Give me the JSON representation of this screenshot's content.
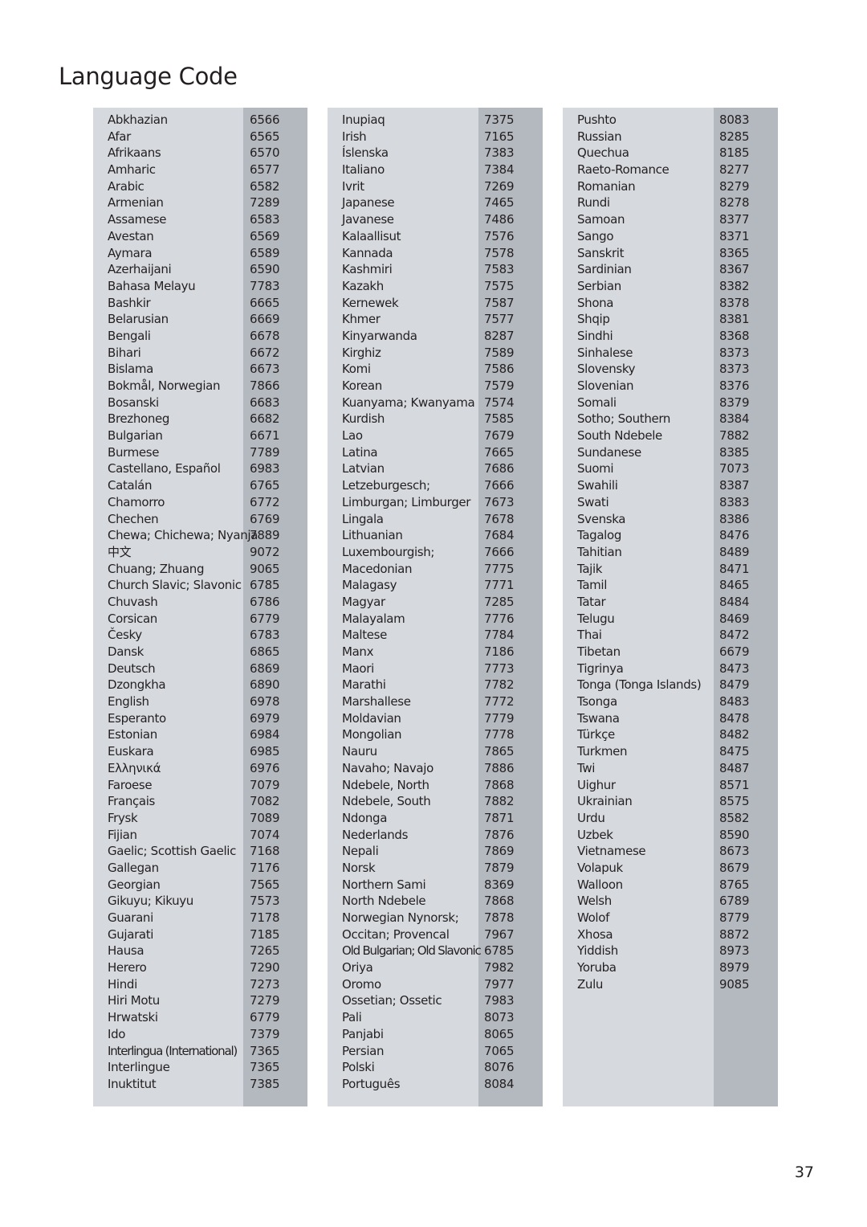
{
  "title": "Language Code",
  "page_number": "37",
  "colors": {
    "name_bg": "#d6dade",
    "code_bg": "#b4b8bf",
    "text": "#231f20"
  },
  "columns": [
    {
      "rows": [
        {
          "name": "Abkhazian",
          "code": "6566"
        },
        {
          "name": "Afar",
          "code": "6565"
        },
        {
          "name": "Afrikaans",
          "code": "6570"
        },
        {
          "name": "Amharic",
          "code": "6577"
        },
        {
          "name": "Arabic",
          "code": "6582"
        },
        {
          "name": "Armenian",
          "code": "7289"
        },
        {
          "name": "Assamese",
          "code": "6583"
        },
        {
          "name": "Avestan",
          "code": "6569"
        },
        {
          "name": "Aymara",
          "code": "6589"
        },
        {
          "name": "Azerhaijani",
          "code": "6590"
        },
        {
          "name": "Bahasa Melayu",
          "code": "7783"
        },
        {
          "name": "Bashkir",
          "code": "6665"
        },
        {
          "name": "Belarusian",
          "code": "6669"
        },
        {
          "name": "Bengali",
          "code": "6678"
        },
        {
          "name": "Bihari",
          "code": "6672"
        },
        {
          "name": "Bislama",
          "code": "6673"
        },
        {
          "name": "Bokmål, Norwegian",
          "code": "7866"
        },
        {
          "name": "Bosanski",
          "code": "6683"
        },
        {
          "name": "Brezhoneg",
          "code": "6682"
        },
        {
          "name": "Bulgarian",
          "code": "6671"
        },
        {
          "name": "Burmese",
          "code": "7789"
        },
        {
          "name": "Castellano, Español",
          "code": "6983"
        },
        {
          "name": "Catalán",
          "code": "6765"
        },
        {
          "name": "Chamorro",
          "code": "6772"
        },
        {
          "name": "Chechen",
          "code": "6769"
        },
        {
          "name": "Chewa; Chichewa; Nyanja",
          "code": "7889"
        },
        {
          "name": "中文",
          "code": "9072"
        },
        {
          "name": "Chuang; Zhuang",
          "code": "9065"
        },
        {
          "name": "Church Slavic; Slavonic",
          "code": "6785"
        },
        {
          "name": "Chuvash",
          "code": "6786"
        },
        {
          "name": "Corsican",
          "code": "6779"
        },
        {
          "name": "Česky",
          "code": "6783"
        },
        {
          "name": "Dansk",
          "code": "6865"
        },
        {
          "name": "Deutsch",
          "code": "6869"
        },
        {
          "name": "Dzongkha",
          "code": "6890"
        },
        {
          "name": "English",
          "code": "6978"
        },
        {
          "name": "Esperanto",
          "code": "6979"
        },
        {
          "name": "Estonian",
          "code": "6984"
        },
        {
          "name": "Euskara",
          "code": "6985"
        },
        {
          "name": "Ελληνικά",
          "code": "6976"
        },
        {
          "name": "Faroese",
          "code": "7079"
        },
        {
          "name": "Français",
          "code": "7082"
        },
        {
          "name": "Frysk",
          "code": "7089"
        },
        {
          "name": "Fijian",
          "code": "7074"
        },
        {
          "name": "Gaelic; Scottish Gaelic",
          "code": "7168"
        },
        {
          "name": "Gallegan",
          "code": "7176"
        },
        {
          "name": "Georgian",
          "code": "7565"
        },
        {
          "name": "Gikuyu; Kikuyu",
          "code": "7573"
        },
        {
          "name": "Guarani",
          "code": "7178"
        },
        {
          "name": "Gujarati",
          "code": "7185"
        },
        {
          "name": "Hausa",
          "code": "7265"
        },
        {
          "name": "Herero",
          "code": "7290"
        },
        {
          "name": "Hindi",
          "code": "7273"
        },
        {
          "name": "Hiri Motu",
          "code": "7279"
        },
        {
          "name": "Hrwatski",
          "code": "6779"
        },
        {
          "name": "Ido",
          "code": "7379"
        },
        {
          "name": "Interlingua (International)",
          "code": "7365"
        },
        {
          "name": "Interlingue",
          "code": "7365"
        },
        {
          "name": "Inuktitut",
          "code": "7385"
        }
      ]
    },
    {
      "rows": [
        {
          "name": "Inupiaq",
          "code": "7375"
        },
        {
          "name": "Irish",
          "code": "7165"
        },
        {
          "name": "Íslenska",
          "code": "7383"
        },
        {
          "name": "Italiano",
          "code": "7384"
        },
        {
          "name": "Ivrit",
          "code": "7269"
        },
        {
          "name": "Japanese",
          "code": "7465"
        },
        {
          "name": "Javanese",
          "code": "7486"
        },
        {
          "name": "Kalaallisut",
          "code": "7576"
        },
        {
          "name": "Kannada",
          "code": "7578"
        },
        {
          "name": "Kashmiri",
          "code": "7583"
        },
        {
          "name": "Kazakh",
          "code": "7575"
        },
        {
          "name": "Kernewek",
          "code": "7587"
        },
        {
          "name": "Khmer",
          "code": "7577"
        },
        {
          "name": "Kinyarwanda",
          "code": "8287"
        },
        {
          "name": "Kirghiz",
          "code": "7589"
        },
        {
          "name": "Komi",
          "code": "7586"
        },
        {
          "name": "Korean",
          "code": "7579"
        },
        {
          "name": "Kuanyama; Kwanyama",
          "code": "7574"
        },
        {
          "name": "Kurdish",
          "code": "7585"
        },
        {
          "name": "Lao",
          "code": "7679"
        },
        {
          "name": "Latina",
          "code": "7665"
        },
        {
          "name": "Latvian",
          "code": "7686"
        },
        {
          "name": "Letzeburgesch;",
          "code": "7666"
        },
        {
          "name": "Limburgan; Limburger",
          "code": "7673"
        },
        {
          "name": "Lingala",
          "code": "7678"
        },
        {
          "name": "Lithuanian",
          "code": "7684"
        },
        {
          "name": "Luxembourgish;",
          "code": "7666"
        },
        {
          "name": "Macedonian",
          "code": "7775"
        },
        {
          "name": "Malagasy",
          "code": "7771"
        },
        {
          "name": "Magyar",
          "code": "7285"
        },
        {
          "name": "Malayalam",
          "code": "7776"
        },
        {
          "name": "Maltese",
          "code": "7784"
        },
        {
          "name": "Manx",
          "code": "7186"
        },
        {
          "name": "Maori",
          "code": "7773"
        },
        {
          "name": "Marathi",
          "code": "7782"
        },
        {
          "name": "Marshallese",
          "code": "7772"
        },
        {
          "name": "Moldavian",
          "code": "7779"
        },
        {
          "name": "Mongolian",
          "code": "7778"
        },
        {
          "name": "Nauru",
          "code": "7865"
        },
        {
          "name": "Navaho; Navajo",
          "code": "7886"
        },
        {
          "name": "Ndebele, North",
          "code": "7868"
        },
        {
          "name": "Ndebele, South",
          "code": "7882"
        },
        {
          "name": "Ndonga",
          "code": "7871"
        },
        {
          "name": "Nederlands",
          "code": "7876"
        },
        {
          "name": "Nepali",
          "code": "7869"
        },
        {
          "name": "Norsk",
          "code": "7879"
        },
        {
          "name": "Northern Sami",
          "code": "8369"
        },
        {
          "name": "North Ndebele",
          "code": "7868"
        },
        {
          "name": "Norwegian Nynorsk;",
          "code": "7878"
        },
        {
          "name": "Occitan; Provencal",
          "code": "7967"
        },
        {
          "name": "Old Bulgarian; Old Slavonic",
          "code": "6785"
        },
        {
          "name": "Oriya",
          "code": "7982"
        },
        {
          "name": "Oromo",
          "code": "7977"
        },
        {
          "name": "Ossetian; Ossetic",
          "code": "7983"
        },
        {
          "name": "Pali",
          "code": "8073"
        },
        {
          "name": "Panjabi",
          "code": "8065"
        },
        {
          "name": "Persian",
          "code": "7065"
        },
        {
          "name": "Polski",
          "code": "8076"
        },
        {
          "name": "Português",
          "code": "8084"
        }
      ]
    },
    {
      "rows": [
        {
          "name": "Pushto",
          "code": "8083"
        },
        {
          "name": "Russian",
          "code": "8285"
        },
        {
          "name": "Quechua",
          "code": "8185"
        },
        {
          "name": "Raeto-Romance",
          "code": "8277"
        },
        {
          "name": "Romanian",
          "code": "8279"
        },
        {
          "name": "Rundi",
          "code": "8278"
        },
        {
          "name": "Samoan",
          "code": "8377"
        },
        {
          "name": "Sango",
          "code": "8371"
        },
        {
          "name": "Sanskrit",
          "code": "8365"
        },
        {
          "name": "Sardinian",
          "code": "8367"
        },
        {
          "name": "Serbian",
          "code": "8382"
        },
        {
          "name": "Shona",
          "code": "8378"
        },
        {
          "name": "Shqip",
          "code": "8381"
        },
        {
          "name": "Sindhi",
          "code": "8368"
        },
        {
          "name": "Sinhalese",
          "code": "8373"
        },
        {
          "name": "Slovensky",
          "code": "8373"
        },
        {
          "name": "Slovenian",
          "code": "8376"
        },
        {
          "name": "Somali",
          "code": "8379"
        },
        {
          "name": "Sotho; Southern",
          "code": "8384"
        },
        {
          "name": "South Ndebele",
          "code": "7882"
        },
        {
          "name": "Sundanese",
          "code": "8385"
        },
        {
          "name": "Suomi",
          "code": "7073"
        },
        {
          "name": "Swahili",
          "code": "8387"
        },
        {
          "name": "Swati",
          "code": "8383"
        },
        {
          "name": "Svenska",
          "code": "8386"
        },
        {
          "name": "Tagalog",
          "code": "8476"
        },
        {
          "name": "Tahitian",
          "code": "8489"
        },
        {
          "name": "Tajik",
          "code": "8471"
        },
        {
          "name": "Tamil",
          "code": "8465"
        },
        {
          "name": "Tatar",
          "code": "8484"
        },
        {
          "name": "Telugu",
          "code": "8469"
        },
        {
          "name": "Thai",
          "code": "8472"
        },
        {
          "name": "Tibetan",
          "code": "6679"
        },
        {
          "name": "Tigrinya",
          "code": "8473"
        },
        {
          "name": "Tonga (Tonga Islands)",
          "code": "8479"
        },
        {
          "name": "Tsonga",
          "code": "8483"
        },
        {
          "name": "Tswana",
          "code": "8478"
        },
        {
          "name": "Türkçe",
          "code": "8482"
        },
        {
          "name": "Turkmen",
          "code": "8475"
        },
        {
          "name": "Twi",
          "code": "8487"
        },
        {
          "name": "Uighur",
          "code": "8571"
        },
        {
          "name": "Ukrainian",
          "code": "8575"
        },
        {
          "name": "Urdu",
          "code": "8582"
        },
        {
          "name": "Uzbek",
          "code": "8590"
        },
        {
          "name": "Vietnamese",
          "code": "8673"
        },
        {
          "name": "Volapuk",
          "code": "8679"
        },
        {
          "name": "Walloon",
          "code": "8765"
        },
        {
          "name": "Welsh",
          "code": "6789"
        },
        {
          "name": "Wolof",
          "code": "8779"
        },
        {
          "name": "Xhosa",
          "code": "8872"
        },
        {
          "name": "Yiddish",
          "code": "8973"
        },
        {
          "name": "Yoruba",
          "code": "8979"
        },
        {
          "name": "Zulu",
          "code": "9085"
        }
      ]
    }
  ]
}
